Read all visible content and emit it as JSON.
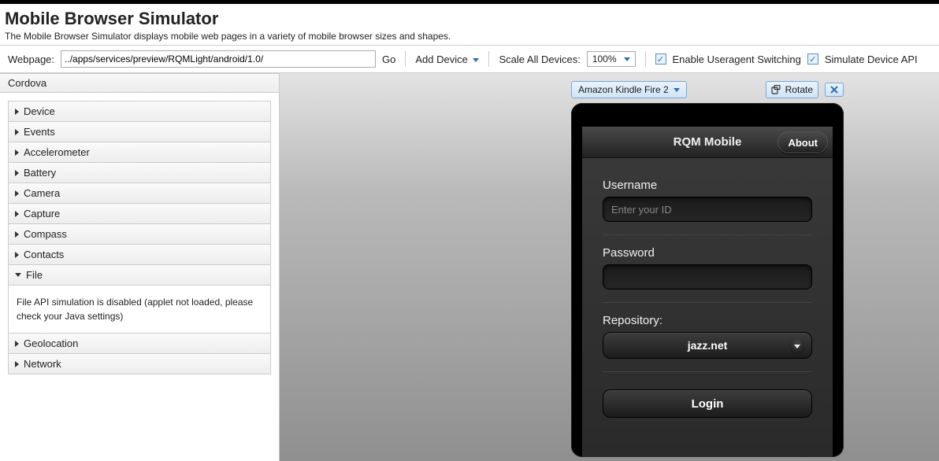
{
  "header": {
    "title": "Mobile Browser Simulator",
    "subtitle": "The Mobile Browser Simulator displays mobile web pages in a variety of mobile browser sizes and shapes."
  },
  "toolbar": {
    "webpage_label": "Webpage:",
    "webpage_value": "../apps/services/preview/RQMLight/android/1.0/",
    "go_label": "Go",
    "add_device_label": "Add Device",
    "scale_label": "Scale All Devices:",
    "scale_value": "100%",
    "useragent_label": "Enable Useragent Switching",
    "simulate_label": "Simulate Device API"
  },
  "sidebar": {
    "panel_title": "Cordova",
    "items": [
      {
        "label": "Device",
        "expanded": false
      },
      {
        "label": "Events",
        "expanded": false
      },
      {
        "label": "Accelerometer",
        "expanded": false
      },
      {
        "label": "Battery",
        "expanded": false
      },
      {
        "label": "Camera",
        "expanded": false
      },
      {
        "label": "Capture",
        "expanded": false
      },
      {
        "label": "Compass",
        "expanded": false
      },
      {
        "label": "Contacts",
        "expanded": false
      },
      {
        "label": "File",
        "expanded": true,
        "content": "File API simulation is disabled (applet not loaded, please check your Java settings)"
      },
      {
        "label": "Geolocation",
        "expanded": false
      },
      {
        "label": "Network",
        "expanded": false
      }
    ]
  },
  "device": {
    "name": "Amazon Kindle Fire 2",
    "rotate_label": "Rotate",
    "app": {
      "title": "RQM Mobile",
      "about_label": "About",
      "username_label": "Username",
      "username_placeholder": "Enter your ID",
      "password_label": "Password",
      "repository_label": "Repository:",
      "repository_value": "jazz.net",
      "login_label": "Login"
    }
  }
}
